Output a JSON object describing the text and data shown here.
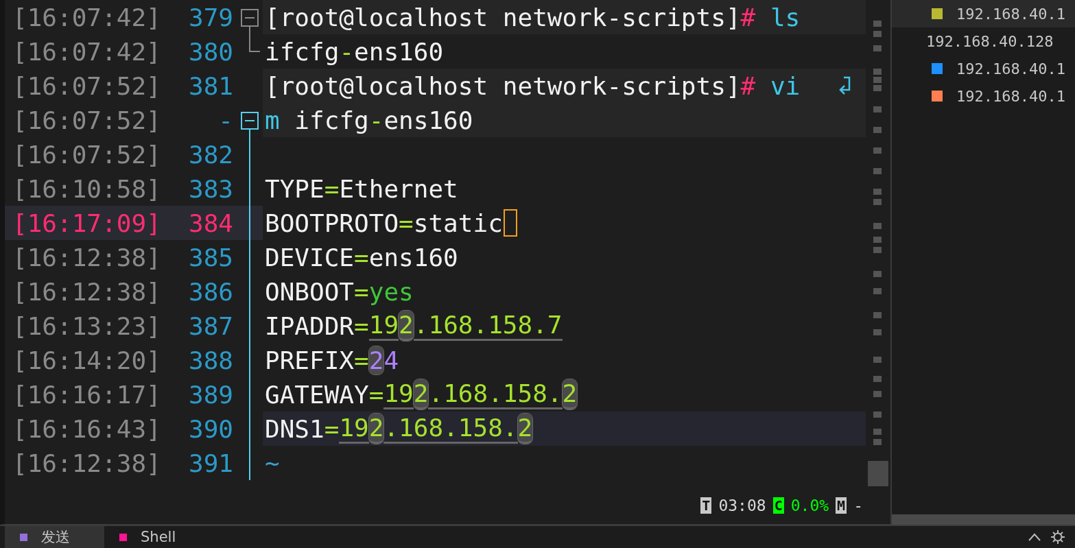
{
  "terminal": {
    "lines": [
      {
        "time": "[16:07:42]",
        "number": "379",
        "fold": {
          "kind": "open",
          "active": false
        },
        "highlighted": true,
        "hovered": false,
        "current": false,
        "cursor": false,
        "wrap": false,
        "segments": [
          {
            "text": "[root@localhost network-scripts]",
            "kind": "text"
          },
          {
            "text": "#",
            "kind": "hash"
          },
          {
            "text": " ls",
            "kind": "cmd"
          }
        ]
      },
      {
        "time": "[16:07:42]",
        "number": "380",
        "fold": {
          "kind": "end"
        },
        "highlighted": false,
        "hovered": false,
        "current": false,
        "cursor": false,
        "wrap": false,
        "segments": [
          {
            "text": "ifcfg",
            "kind": "text"
          },
          {
            "text": "-",
            "kind": "dash"
          },
          {
            "text": "ens160",
            "kind": "text"
          }
        ]
      },
      {
        "time": "[16:07:52]",
        "number": "381",
        "highlighted": true,
        "hovered": false,
        "current": false,
        "cursor": false,
        "wrap": true,
        "segments": [
          {
            "text": "[root@localhost network-scripts]",
            "kind": "text"
          },
          {
            "text": "#",
            "kind": "hash"
          },
          {
            "text": " vi",
            "kind": "cmd"
          }
        ]
      },
      {
        "time": "[16:07:52]",
        "number": "-",
        "fold": {
          "kind": "open",
          "active": true
        },
        "highlighted": true,
        "hovered": false,
        "current": false,
        "cursor": false,
        "wrap": false,
        "segments": [
          {
            "text": "m",
            "kind": "cmd"
          },
          {
            "text": " ifcfg",
            "kind": "text"
          },
          {
            "text": "-",
            "kind": "dash"
          },
          {
            "text": "ens160",
            "kind": "text"
          }
        ]
      },
      {
        "time": "[16:07:52]",
        "number": "382",
        "fold": {
          "kind": "line"
        },
        "highlighted": false,
        "hovered": false,
        "current": false,
        "cursor": false,
        "wrap": false
      },
      {
        "time": "[16:10:58]",
        "number": "383",
        "fold": {
          "kind": "line"
        },
        "highlighted": false,
        "hovered": false,
        "current": false,
        "cursor": false,
        "wrap": false,
        "segments": [
          {
            "text": "TYPE",
            "kind": "text"
          },
          {
            "text": "=",
            "kind": "eq"
          },
          {
            "text": "Ethernet",
            "kind": "text"
          }
        ]
      },
      {
        "time": "[16:17:09]",
        "number": "384",
        "fold": {
          "kind": "line"
        },
        "highlighted": false,
        "hovered": false,
        "current": true,
        "cursor": true,
        "wrap": false,
        "segments": [
          {
            "text": "BOOTPROTO",
            "kind": "text"
          },
          {
            "text": "=",
            "kind": "eq"
          },
          {
            "text": "static",
            "kind": "text"
          }
        ]
      },
      {
        "time": "[16:12:38]",
        "number": "385",
        "fold": {
          "kind": "line"
        },
        "highlighted": false,
        "hovered": false,
        "current": false,
        "cursor": false,
        "wrap": false,
        "segments": [
          {
            "text": "DEVICE",
            "kind": "text"
          },
          {
            "text": "=",
            "kind": "eq"
          },
          {
            "text": "ens160",
            "kind": "text"
          }
        ]
      },
      {
        "time": "[16:12:38]",
        "number": "386",
        "fold": {
          "kind": "line"
        },
        "highlighted": false,
        "hovered": false,
        "current": false,
        "cursor": false,
        "wrap": false,
        "segments": [
          {
            "text": "ONBOOT",
            "kind": "text"
          },
          {
            "text": "=",
            "kind": "eq"
          },
          {
            "text": "yes",
            "kind": "ok"
          }
        ]
      },
      {
        "time": "[16:13:23]",
        "number": "387",
        "fold": {
          "kind": "line"
        },
        "highlighted": false,
        "hovered": false,
        "current": false,
        "cursor": false,
        "wrap": false,
        "segments": [
          {
            "text": "IPADDR",
            "kind": "text"
          },
          {
            "text": "=",
            "kind": "eq"
          },
          {
            "text": "19",
            "kind": "ip"
          },
          {
            "text": "2",
            "kind": "ipmatch"
          },
          {
            "text": ".168.158.7",
            "kind": "ip"
          }
        ]
      },
      {
        "time": "[16:14:20]",
        "number": "388",
        "fold": {
          "kind": "line"
        },
        "highlighted": false,
        "hovered": false,
        "current": false,
        "cursor": false,
        "wrap": false,
        "segments": [
          {
            "text": "PREFIX",
            "kind": "text"
          },
          {
            "text": "=",
            "kind": "eq"
          },
          {
            "text": "2",
            "kind": "nummatch"
          },
          {
            "text": "4",
            "kind": "num"
          }
        ]
      },
      {
        "time": "[16:16:17]",
        "number": "389",
        "fold": {
          "kind": "line"
        },
        "highlighted": false,
        "hovered": false,
        "current": false,
        "cursor": false,
        "wrap": false,
        "segments": [
          {
            "text": "GATEWAY",
            "kind": "text"
          },
          {
            "text": "=",
            "kind": "eq"
          },
          {
            "text": "19",
            "kind": "ip"
          },
          {
            "text": "2",
            "kind": "ipmatch"
          },
          {
            "text": ".168.158.",
            "kind": "ip"
          },
          {
            "text": "2",
            "kind": "ipmatch"
          }
        ]
      },
      {
        "time": "[16:16:43]",
        "number": "390",
        "fold": {
          "kind": "line"
        },
        "highlighted": false,
        "hovered": true,
        "current": false,
        "cursor": false,
        "wrap": false,
        "segments": [
          {
            "text": "DNS1",
            "kind": "text"
          },
          {
            "text": "=",
            "kind": "eq"
          },
          {
            "text": "19",
            "kind": "ip"
          },
          {
            "text": "2",
            "kind": "ipmatch"
          },
          {
            "text": ".168.158.",
            "kind": "ip"
          },
          {
            "text": "2",
            "kind": "ipmatch"
          }
        ]
      },
      {
        "time": "[16:12:38]",
        "number": "391",
        "fold": {
          "kind": "line"
        },
        "highlighted": false,
        "hovered": false,
        "current": false,
        "cursor": false,
        "wrap": false,
        "segments": [
          {
            "text": "~",
            "kind": "tilde"
          }
        ]
      }
    ],
    "status": [
      {
        "kind": "badge",
        "text": "T"
      },
      {
        "kind": "text",
        "text": "03:08"
      },
      {
        "kind": "badgeon",
        "text": "C"
      },
      {
        "kind": "texton",
        "text": "0.0%"
      },
      {
        "kind": "badge",
        "text": "M"
      },
      {
        "kind": "text",
        "text": "-"
      }
    ]
  },
  "sessions": [
    {
      "label": "192.168.40.1",
      "kind": "host",
      "color": "#b8b832",
      "selected": true
    },
    {
      "label": "192.168.40.128",
      "kind": "group",
      "selected": false
    },
    {
      "label": "192.168.40.1",
      "kind": "host",
      "color": "#1e90ff",
      "selected": false
    },
    {
      "label": "192.168.40.1",
      "kind": "host",
      "color": "#ff7f50",
      "selected": false
    }
  ],
  "tabs": [
    {
      "label": "发送",
      "color": "#9370db",
      "selected": true
    },
    {
      "label": "Shell",
      "color": "#ff1493",
      "selected": false
    }
  ]
}
